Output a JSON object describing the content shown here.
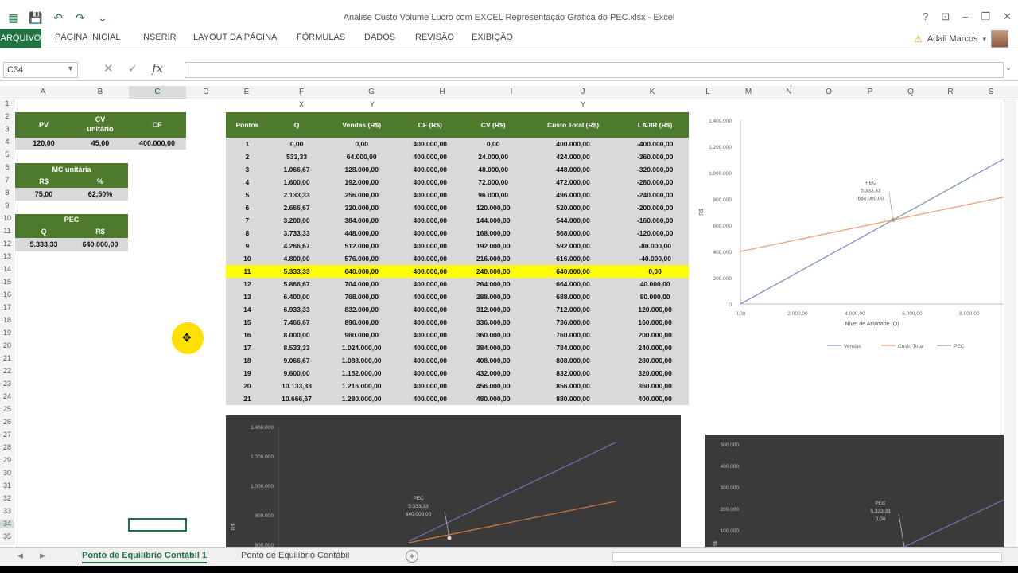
{
  "window": {
    "title": "Análise Custo Volume Lucro com EXCEL Representação Gráfica do PEC.xlsx - Excel"
  },
  "ribbon": {
    "tabs": [
      "ARQUIVO",
      "PÁGINA INICIAL",
      "INSERIR",
      "LAYOUT DA PÁGINA",
      "FÓRMULAS",
      "DADOS",
      "REVISÃO",
      "EXIBIÇÃO"
    ],
    "user": "Adail Marcos"
  },
  "formula_bar": {
    "name_box": "C34",
    "fx": "fx",
    "value": ""
  },
  "columns": [
    "A",
    "B",
    "C",
    "D",
    "E",
    "F",
    "G",
    "H",
    "I",
    "J",
    "K",
    "L",
    "M",
    "N",
    "O",
    "P",
    "Q",
    "R",
    "S"
  ],
  "rows": [
    "1",
    "2",
    "3",
    "4",
    "5",
    "6",
    "7",
    "8",
    "9",
    "10",
    "11",
    "12",
    "13",
    "14",
    "15",
    "16",
    "17",
    "18",
    "19",
    "20",
    "21",
    "22",
    "23",
    "24",
    "25",
    "26",
    "27",
    "28",
    "29",
    "30",
    "31",
    "32",
    "33",
    "34",
    "35"
  ],
  "inputs": {
    "pv_label": "PV",
    "cv_label": "CV",
    "cv_label2": "unitário",
    "cf_label": "CF",
    "pv": "120,00",
    "cv": "45,00",
    "cf": "400.000,00",
    "mc_label": "MC unitária",
    "mc_rs_label": "R$",
    "mc_pct_label": "%",
    "mc_rs": "75,00",
    "mc_pct": "62,50%",
    "pec_label": "PEC",
    "pec_q_label": "Q",
    "pec_rs_label": "R$",
    "pec_q": "5.333,33",
    "pec_rs": "640.000,00"
  },
  "axis_marks": {
    "x": "X",
    "y": "Y"
  },
  "table": {
    "headers": [
      "Pontos",
      "Q",
      "Vendas (R$)",
      "CF (R$)",
      "CV (R$)",
      "Custo Total (R$)",
      "LAJIR (R$)"
    ],
    "highlight_row": 11,
    "rows": [
      [
        "1",
        "0,00",
        "0,00",
        "400.000,00",
        "0,00",
        "400.000,00",
        "-400.000,00"
      ],
      [
        "2",
        "533,33",
        "64.000,00",
        "400.000,00",
        "24.000,00",
        "424.000,00",
        "-360.000,00"
      ],
      [
        "3",
        "1.066,67",
        "128.000,00",
        "400.000,00",
        "48.000,00",
        "448.000,00",
        "-320.000,00"
      ],
      [
        "4",
        "1.600,00",
        "192.000,00",
        "400.000,00",
        "72.000,00",
        "472.000,00",
        "-280.000,00"
      ],
      [
        "5",
        "2.133,33",
        "256.000,00",
        "400.000,00",
        "96.000,00",
        "496.000,00",
        "-240.000,00"
      ],
      [
        "6",
        "2.666,67",
        "320.000,00",
        "400.000,00",
        "120.000,00",
        "520.000,00",
        "-200.000,00"
      ],
      [
        "7",
        "3.200,00",
        "384.000,00",
        "400.000,00",
        "144.000,00",
        "544.000,00",
        "-160.000,00"
      ],
      [
        "8",
        "3.733,33",
        "448.000,00",
        "400.000,00",
        "168.000,00",
        "568.000,00",
        "-120.000,00"
      ],
      [
        "9",
        "4.266,67",
        "512.000,00",
        "400.000,00",
        "192.000,00",
        "592.000,00",
        "-80.000,00"
      ],
      [
        "10",
        "4.800,00",
        "576.000,00",
        "400.000,00",
        "216.000,00",
        "616.000,00",
        "-40.000,00"
      ],
      [
        "11",
        "5.333,33",
        "640.000,00",
        "400.000,00",
        "240.000,00",
        "640.000,00",
        "0,00"
      ],
      [
        "12",
        "5.866,67",
        "704.000,00",
        "400.000,00",
        "264.000,00",
        "664.000,00",
        "40.000,00"
      ],
      [
        "13",
        "6.400,00",
        "768.000,00",
        "400.000,00",
        "288.000,00",
        "688.000,00",
        "80.000,00"
      ],
      [
        "14",
        "6.933,33",
        "832.000,00",
        "400.000,00",
        "312.000,00",
        "712.000,00",
        "120.000,00"
      ],
      [
        "15",
        "7.466,67",
        "896.000,00",
        "400.000,00",
        "336.000,00",
        "736.000,00",
        "160.000,00"
      ],
      [
        "16",
        "8.000,00",
        "960.000,00",
        "400.000,00",
        "360.000,00",
        "760.000,00",
        "200.000,00"
      ],
      [
        "17",
        "8.533,33",
        "1.024.000,00",
        "400.000,00",
        "384.000,00",
        "784.000,00",
        "240.000,00"
      ],
      [
        "18",
        "9.066,67",
        "1.088.000,00",
        "400.000,00",
        "408.000,00",
        "808.000,00",
        "280.000,00"
      ],
      [
        "19",
        "9.600,00",
        "1.152.000,00",
        "400.000,00",
        "432.000,00",
        "832.000,00",
        "320.000,00"
      ],
      [
        "20",
        "10.133,33",
        "1.216.000,00",
        "400.000,00",
        "456.000,00",
        "856.000,00",
        "360.000,00"
      ],
      [
        "21",
        "10.666,67",
        "1.280.000,00",
        "400.000,00",
        "480.000,00",
        "880.000,00",
        "400.000,00"
      ]
    ]
  },
  "chart_main": {
    "y_ticks": [
      "1.400.000",
      "1.200.000",
      "1.000.000",
      "800.000",
      "600.000",
      "400.000",
      "200.000",
      "0"
    ],
    "x_ticks": [
      "0,00",
      "2.000,00",
      "4.000,00",
      "6.000,00",
      "8.000,00"
    ],
    "xlabel": "Nível de Atividade (Q)",
    "ylabel": "R$",
    "pec_label": "PEC",
    "pec_q": "5.333,33",
    "pec_rs": "640.000,00",
    "legend": [
      "Vendas",
      "Custo Total",
      "PEC"
    ]
  },
  "chart_dark1": {
    "y_ticks": [
      "1.400.000",
      "1.200.000",
      "1.000.000",
      "800.000",
      "600.000"
    ],
    "ylabel": "R$",
    "pec_label": "PEC",
    "pec_q": "5.333,33",
    "pec_rs": "640.000,00"
  },
  "chart_dark2": {
    "y_ticks": [
      "500.000",
      "400.000",
      "300.000",
      "200.000",
      "100.000",
      "0"
    ],
    "ylabel": "R$",
    "pec_label": "PEC",
    "pec_q": "5.333,33",
    "pec_rs": "0,00"
  },
  "chart_data": {
    "type": "line",
    "series": [
      {
        "name": "Vendas",
        "x": [
          0,
          5333.33,
          10666.67
        ],
        "y": [
          0,
          640000,
          1280000
        ],
        "color": "#7f93c8"
      },
      {
        "name": "Custo Total",
        "x": [
          0,
          5333.33,
          10666.67
        ],
        "y": [
          400000,
          640000,
          880000
        ],
        "color": "#f0a070"
      },
      {
        "name": "PEC",
        "x": [
          5333.33
        ],
        "y": [
          640000
        ],
        "color": "#999999"
      }
    ],
    "xlabel": "Nível de Atividade (Q)",
    "ylabel": "R$",
    "ylim": [
      0,
      1400000
    ],
    "xlim": [
      0,
      9200
    ]
  },
  "sheets": [
    "Ponto de Equilíbrio Contábil 1",
    "Ponto de Equilíbrio Contábil"
  ],
  "colors": {
    "excel_green": "#217346",
    "header_green": "#4e7a2d",
    "negative": "#e02020",
    "highlight": "#ffff00"
  }
}
